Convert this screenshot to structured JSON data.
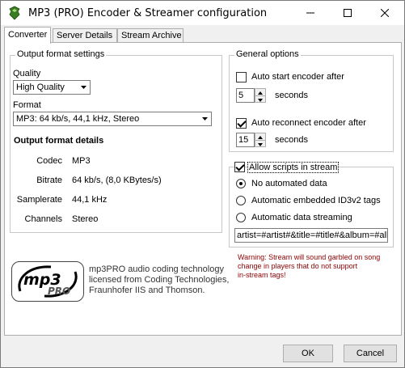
{
  "window": {
    "title": "MP3 (PRO) Encoder & Streamer configuration"
  },
  "tabs": [
    {
      "label": "Converter",
      "active": true
    },
    {
      "label": "Server Details",
      "active": false
    },
    {
      "label": "Stream Archive",
      "active": false
    }
  ],
  "output_format": {
    "group_label": "Output format settings",
    "quality_label": "Quality",
    "quality_value": "High Quality",
    "format_label": "Format",
    "format_value": "MP3: 64 kb/s, 44,1 kHz, Stereo",
    "details_heading": "Output format details",
    "details": [
      {
        "label": "Codec",
        "value": "MP3"
      },
      {
        "label": "Bitrate",
        "value": "64 kb/s, (8,0 KBytes/s)"
      },
      {
        "label": "Samplerate",
        "value": "44,1 kHz"
      },
      {
        "label": "Channels",
        "value": "Stereo"
      }
    ]
  },
  "general_options": {
    "group_label": "General options",
    "auto_start_label": "Auto start encoder after",
    "auto_start_checked": false,
    "auto_start_seconds": "5",
    "auto_reconnect_label": "Auto reconnect encoder after",
    "auto_reconnect_checked": true,
    "auto_reconnect_seconds": "15",
    "seconds_label": "seconds"
  },
  "scripts": {
    "group_label": "Allow scripts in stream",
    "checked": true,
    "options": [
      {
        "label": "No automated data",
        "selected": true
      },
      {
        "label": "Automatic embedded ID3v2 tags",
        "selected": false
      },
      {
        "label": "Automatic data streaming",
        "selected": false
      }
    ],
    "template_value": "artist=#artist#&title=#title#&album=#album#",
    "warning_lines": [
      "Warning: Stream will sound garbled on song",
      "change in players that do not support",
      "in-stream tags!"
    ]
  },
  "info": {
    "lines": [
      "mp3PRO audio coding technology",
      "licensed from Coding Technologies,",
      "Fraunhofer IIS and Thomson."
    ]
  },
  "buttons": {
    "ok": "OK",
    "cancel": "Cancel"
  }
}
